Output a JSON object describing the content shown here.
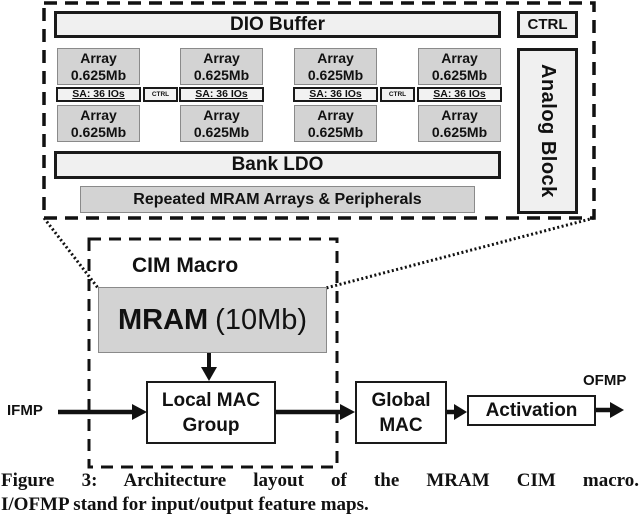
{
  "figure": {
    "detail_layout": {
      "dio_buffer_label": "DIO Buffer",
      "ctrl_label": "CTRL",
      "analog_block_label": "Analog Block",
      "bank_ldo_label": "Bank LDO",
      "repeated_label": "Repeated MRAM Arrays & Peripherals",
      "array_groups": [
        {
          "top_array": {
            "title": "Array",
            "size": "0.625Mb"
          },
          "sense_amp": "SA: 36 IOs",
          "bottom_array": {
            "title": "Array",
            "size": "0.625Mb"
          }
        },
        {
          "top_array": {
            "title": "Array",
            "size": "0.625Mb"
          },
          "sense_amp": "SA: 36 IOs",
          "bottom_array": {
            "title": "Array",
            "size": "0.625Mb"
          }
        },
        {
          "top_array": {
            "title": "Array",
            "size": "0.625Mb"
          },
          "sense_amp": "SA: 36 IOs",
          "bottom_array": {
            "title": "Array",
            "size": "0.625Mb"
          }
        },
        {
          "top_array": {
            "title": "Array",
            "size": "0.625Mb"
          },
          "sense_amp": "SA: 36 IOs",
          "bottom_array": {
            "title": "Array",
            "size": "0.625Mb"
          }
        }
      ],
      "inner_ctrl_labels": [
        "CTRL",
        "CTRL"
      ]
    },
    "macro": {
      "title": "CIM Macro",
      "mram_name": "MRAM",
      "mram_size": "(10Mb)",
      "local_mac_line1": "Local MAC",
      "local_mac_line2": "Group"
    },
    "pipeline": {
      "input_label": "IFMP",
      "global_mac_line1": "Global",
      "global_mac_line2": "MAC",
      "activation_label": "Activation",
      "output_label": "OFMP"
    },
    "caption": {
      "line1": "Figure 3: Architecture layout of the MRAM CIM macro.",
      "line2": "I/OFMP stand for input/output feature maps."
    }
  }
}
